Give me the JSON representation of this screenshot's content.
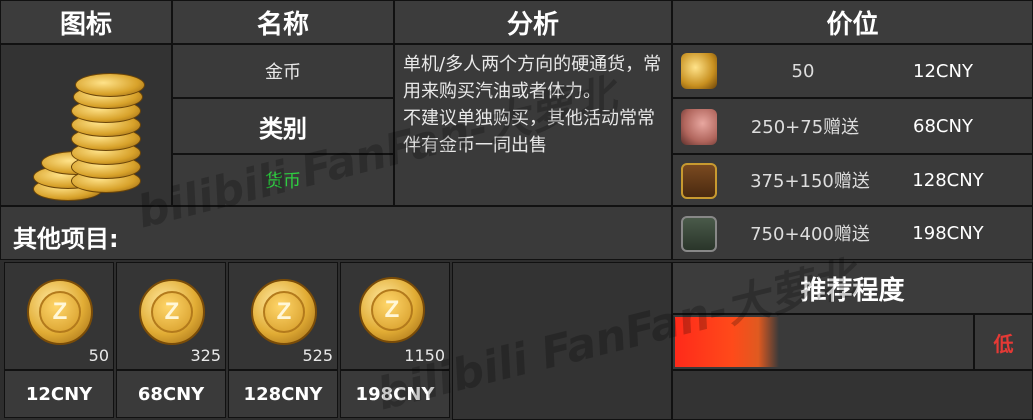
{
  "headers": {
    "icon": "图标",
    "name": "名称",
    "analysis": "分析",
    "price": "价位"
  },
  "item": {
    "name": "金币",
    "category_label": "类别",
    "category_value": "货币",
    "category_color": "#2ecc40"
  },
  "analysis": {
    "para1": "单机/多人两个方向的硬通货，常用来购买汽油或者体力。",
    "para2": "不建议单独购买，其他活动常常伴有金币一同出售"
  },
  "price_rows": [
    {
      "icon": "coin-stack-icon",
      "amount": "50",
      "price": "12CNY"
    },
    {
      "icon": "piggy-bank-icon",
      "amount": "250+75赠送",
      "price": "68CNY"
    },
    {
      "icon": "treasure-chest-icon",
      "amount": "375+150赠送",
      "price": "128CNY"
    },
    {
      "icon": "safe-icon",
      "amount": "750+400赠送",
      "price": "198CNY"
    }
  ],
  "other_items": {
    "title": "其他项目:",
    "items": [
      {
        "amount": "50",
        "price": "12CNY"
      },
      {
        "amount": "325",
        "price": "68CNY"
      },
      {
        "amount": "525",
        "price": "128CNY"
      },
      {
        "amount": "1150",
        "price": "198CNY"
      }
    ]
  },
  "recommend": {
    "title": "推荐程度",
    "level": "低",
    "level_color": "#e53935",
    "fill_fraction": 0.35
  },
  "watermark": {
    "line1": "bilibili FanFan-大萝北",
    "line2": "bilibili FanFan-大萝北"
  }
}
